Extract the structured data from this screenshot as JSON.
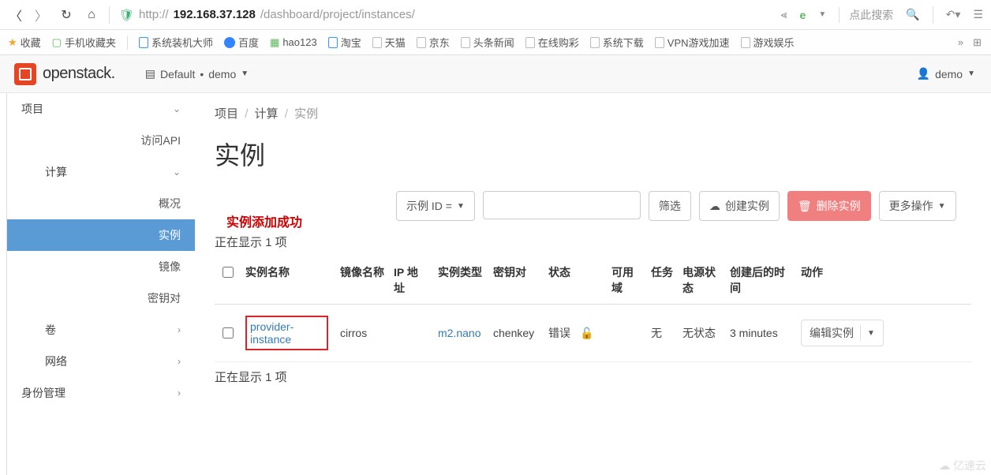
{
  "browser": {
    "url_prefix": "http://",
    "url_host": "192.168.37.128",
    "url_path": "/dashboard/project/instances/",
    "search_placeholder": "点此搜索"
  },
  "bookmarks": {
    "fav": "收藏",
    "mobile": "手机收藏夹",
    "b1": "系统装机大师",
    "b2": "百度",
    "b3": "hao123",
    "b4": "淘宝",
    "b5": "天猫",
    "b6": "京东",
    "b7": "头条新闻",
    "b8": "在线购彩",
    "b9": "系统下载",
    "b10": "VPN游戏加速",
    "b11": "游戏娱乐"
  },
  "header": {
    "brand": "openstack.",
    "domain_label": "Default",
    "project_label": "demo",
    "user_label": "demo"
  },
  "sidebar": {
    "project": "项目",
    "api": "访问API",
    "compute": "计算",
    "overview": "概况",
    "instances": "实例",
    "images": "镜像",
    "keypairs": "密钥对",
    "volumes": "卷",
    "network": "网络",
    "identity": "身份管理"
  },
  "page": {
    "bc_project": "项目",
    "bc_compute": "计算",
    "bc_instances": "实例",
    "title": "实例",
    "success": "实例添加成功",
    "filter_id": "示例 ID =",
    "filter_btn": "筛选",
    "create_btn": "创建实例",
    "delete_btn": "删除实例",
    "more_btn": "更多操作",
    "count_top": "正在显示 1 项",
    "count_bottom": "正在显示 1 项"
  },
  "table": {
    "h_name": "实例名称",
    "h_image": "镜像名称",
    "h_ip": "IP 地址",
    "h_flavor": "实例类型",
    "h_key": "密钥对",
    "h_status": "状态",
    "h_az": "可用域",
    "h_task": "任务",
    "h_power": "电源状态",
    "h_age": "创建后的时间",
    "h_actions": "动作"
  },
  "row": {
    "name": "provider-instance",
    "image": "cirros",
    "ip": "",
    "flavor": "m2.nano",
    "key": "chenkey",
    "status": "错误",
    "az": "",
    "task": "无",
    "power": "无状态",
    "age": "3 minutes",
    "action": "编辑实例"
  },
  "watermark": "亿速云"
}
